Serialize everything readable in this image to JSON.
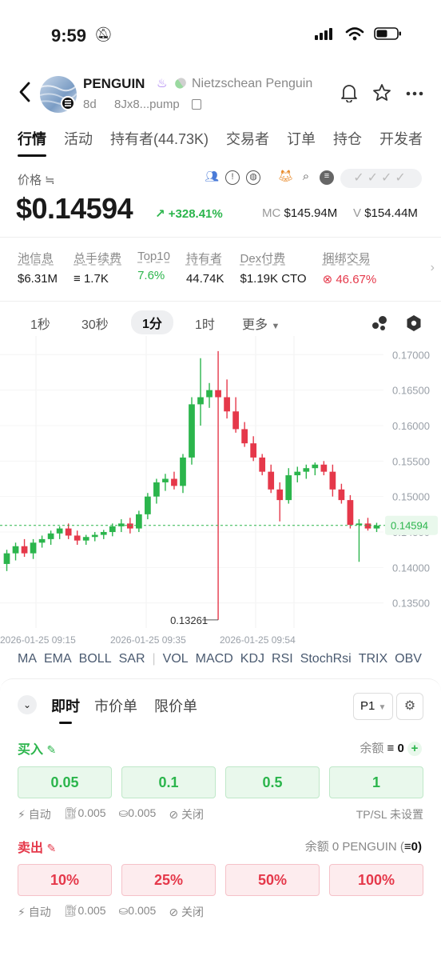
{
  "status": {
    "time": "9:59"
  },
  "header": {
    "token_symbol": "PENGUIN",
    "token_name": "Nietzschean Penguin",
    "age": "8d",
    "address": "8Jx8...pump"
  },
  "tabs": [
    {
      "label": "行情",
      "active": true
    },
    {
      "label": "活动"
    },
    {
      "label": "持有者(44.73K)"
    },
    {
      "label": "交易者"
    },
    {
      "label": "订单"
    },
    {
      "label": "持仓"
    },
    {
      "label": "开发者"
    }
  ],
  "price": {
    "label": "价格 ≒",
    "value": "$0.14594",
    "change": "+328.41%",
    "mc_label": "MC",
    "mc_value": "$145.94M",
    "v_label": "V",
    "v_value": "$154.44M"
  },
  "stats": [
    {
      "label": "池信息",
      "value": "$6.31M"
    },
    {
      "label": "总手续费",
      "value": "1.7K"
    },
    {
      "label": "Top10",
      "value": "7.6%",
      "tone": "green"
    },
    {
      "label": "持有者",
      "value": "44.74K"
    },
    {
      "label": "Dex付费",
      "value": "$1.19K CTO"
    },
    {
      "label": "捆绑交易",
      "value": "46.67%",
      "tone": "red"
    }
  ],
  "timeframes": {
    "s1": "1秒",
    "s30": "30秒",
    "m1": "1分",
    "h1": "1时",
    "more": "更多"
  },
  "chart_data": {
    "type": "candlestick",
    "y_ticks": [
      "0.17000",
      "0.16500",
      "0.16000",
      "0.15500",
      "0.15000",
      "0.14500",
      "0.14000",
      "0.13500"
    ],
    "ylim": [
      0.1326,
      0.1715
    ],
    "x_ticks": [
      "2026-01-25 09:15",
      "2026-01-25 09:35",
      "2026-01-25 09:54"
    ],
    "current_price_label": "0.14594",
    "current_price": 0.14594,
    "low_annotation": "0.13261",
    "low_value": 0.13261,
    "colors": {
      "up": "#2bb54c",
      "down": "#e5384a",
      "price_line": "#2bb54c"
    },
    "candles": [
      {
        "o": 0.1405,
        "h": 0.1425,
        "l": 0.1395,
        "c": 0.142
      },
      {
        "o": 0.142,
        "h": 0.1435,
        "l": 0.141,
        "c": 0.143
      },
      {
        "o": 0.143,
        "h": 0.144,
        "l": 0.1415,
        "c": 0.142
      },
      {
        "o": 0.142,
        "h": 0.144,
        "l": 0.1412,
        "c": 0.1435
      },
      {
        "o": 0.1435,
        "h": 0.1445,
        "l": 0.1428,
        "c": 0.144
      },
      {
        "o": 0.144,
        "h": 0.1452,
        "l": 0.1432,
        "c": 0.1448
      },
      {
        "o": 0.1448,
        "h": 0.1458,
        "l": 0.144,
        "c": 0.1455
      },
      {
        "o": 0.1455,
        "h": 0.1462,
        "l": 0.144,
        "c": 0.1445
      },
      {
        "o": 0.1445,
        "h": 0.1452,
        "l": 0.1432,
        "c": 0.1438
      },
      {
        "o": 0.1438,
        "h": 0.1446,
        "l": 0.1432,
        "c": 0.1443
      },
      {
        "o": 0.1443,
        "h": 0.145,
        "l": 0.1437,
        "c": 0.1446
      },
      {
        "o": 0.1446,
        "h": 0.1453,
        "l": 0.144,
        "c": 0.145
      },
      {
        "o": 0.145,
        "h": 0.1462,
        "l": 0.1444,
        "c": 0.1458
      },
      {
        "o": 0.1458,
        "h": 0.1468,
        "l": 0.145,
        "c": 0.1462
      },
      {
        "o": 0.1462,
        "h": 0.147,
        "l": 0.1448,
        "c": 0.1455
      },
      {
        "o": 0.1455,
        "h": 0.148,
        "l": 0.145,
        "c": 0.1475
      },
      {
        "o": 0.1475,
        "h": 0.1505,
        "l": 0.1468,
        "c": 0.15
      },
      {
        "o": 0.15,
        "h": 0.1525,
        "l": 0.149,
        "c": 0.152
      },
      {
        "o": 0.152,
        "h": 0.1532,
        "l": 0.1508,
        "c": 0.1525
      },
      {
        "o": 0.1525,
        "h": 0.1535,
        "l": 0.151,
        "c": 0.1515
      },
      {
        "o": 0.1515,
        "h": 0.156,
        "l": 0.1505,
        "c": 0.1555
      },
      {
        "o": 0.1555,
        "h": 0.164,
        "l": 0.1545,
        "c": 0.163
      },
      {
        "o": 0.163,
        "h": 0.1695,
        "l": 0.16,
        "c": 0.164
      },
      {
        "o": 0.164,
        "h": 0.166,
        "l": 0.1625,
        "c": 0.165
      },
      {
        "o": 0.165,
        "h": 0.1705,
        "l": 0.13261,
        "c": 0.164
      },
      {
        "o": 0.164,
        "h": 0.1665,
        "l": 0.161,
        "c": 0.162
      },
      {
        "o": 0.162,
        "h": 0.164,
        "l": 0.159,
        "c": 0.1595
      },
      {
        "o": 0.1595,
        "h": 0.1605,
        "l": 0.157,
        "c": 0.1575
      },
      {
        "o": 0.1575,
        "h": 0.1585,
        "l": 0.155,
        "c": 0.1555
      },
      {
        "o": 0.1555,
        "h": 0.156,
        "l": 0.153,
        "c": 0.1535
      },
      {
        "o": 0.1535,
        "h": 0.1545,
        "l": 0.1505,
        "c": 0.151
      },
      {
        "o": 0.151,
        "h": 0.152,
        "l": 0.1465,
        "c": 0.1495
      },
      {
        "o": 0.1495,
        "h": 0.154,
        "l": 0.149,
        "c": 0.153
      },
      {
        "o": 0.153,
        "h": 0.1542,
        "l": 0.152,
        "c": 0.1535
      },
      {
        "o": 0.1535,
        "h": 0.1545,
        "l": 0.1525,
        "c": 0.154
      },
      {
        "o": 0.154,
        "h": 0.1548,
        "l": 0.153,
        "c": 0.1545
      },
      {
        "o": 0.1545,
        "h": 0.155,
        "l": 0.153,
        "c": 0.1535
      },
      {
        "o": 0.1535,
        "h": 0.1545,
        "l": 0.15,
        "c": 0.151
      },
      {
        "o": 0.151,
        "h": 0.1518,
        "l": 0.149,
        "c": 0.1495
      },
      {
        "o": 0.1495,
        "h": 0.1502,
        "l": 0.1455,
        "c": 0.146
      },
      {
        "o": 0.146,
        "h": 0.1468,
        "l": 0.1408,
        "c": 0.1462
      },
      {
        "o": 0.1462,
        "h": 0.147,
        "l": 0.1452,
        "c": 0.1455
      },
      {
        "o": 0.1455,
        "h": 0.1463,
        "l": 0.145,
        "c": 0.1459
      }
    ]
  },
  "indicators": [
    "MA",
    "EMA",
    "BOLL",
    "SAR",
    "VOL",
    "MACD",
    "KDJ",
    "RSI",
    "StochRsi",
    "TRIX",
    "OBV"
  ],
  "order_panel": {
    "tabs": {
      "instant": "即时",
      "market": "市价单",
      "limit": "限价单"
    },
    "preset": "P1",
    "buy": {
      "label": "买入",
      "balance_label": "余额",
      "balance_value": "0",
      "amounts": [
        "0.05",
        "0.1",
        "0.5",
        "1"
      ],
      "auto": "自动",
      "fee1": "0.005",
      "fee2": "0.005",
      "mev": "关闭",
      "tpsl": "TP/SL 未设置"
    },
    "sell": {
      "label": "卖出",
      "balance_text": "余额 0 PENGUIN (",
      "balance_sol": "0)",
      "amounts": [
        "10%",
        "25%",
        "50%",
        "100%"
      ],
      "auto": "自动",
      "fee1": "0.005",
      "fee2": "0.005",
      "mev": "关闭"
    }
  }
}
